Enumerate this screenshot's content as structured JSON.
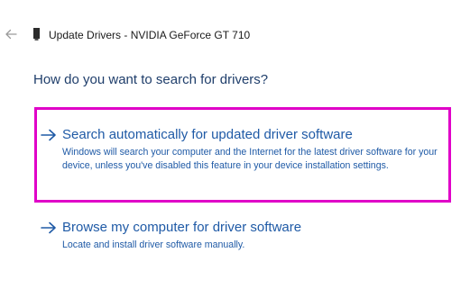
{
  "window": {
    "title": "Update Drivers - NVIDIA GeForce GT 710",
    "back_icon": "back-arrow-icon",
    "device_icon": "graphics-card-icon"
  },
  "heading": "How do you want to search for drivers?",
  "options": [
    {
      "title": "Search automatically for updated driver software",
      "description": "Windows will search your computer and the Internet for the latest driver software for your device, unless you've disabled this feature in your device installation settings.",
      "icon": "arrow-right-icon",
      "highlighted": true
    },
    {
      "title": "Browse my computer for driver software",
      "description": "Locate and install driver software manually.",
      "icon": "arrow-right-icon",
      "highlighted": false
    }
  ],
  "colors": {
    "link": "#1f5aa6",
    "heading": "#1f3e6b",
    "highlight": "#e000c8"
  }
}
